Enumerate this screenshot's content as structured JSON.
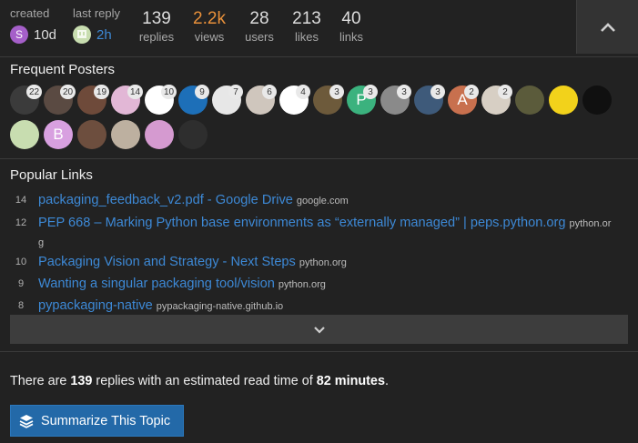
{
  "stats": {
    "created_label": "created",
    "created_initial": "S",
    "created_value": "10d",
    "last_reply_label": "last reply",
    "last_reply_value": "2h",
    "replies_value": "139",
    "replies_label": "replies",
    "views_value": "2.2k",
    "views_label": "views",
    "users_value": "28",
    "users_label": "users",
    "likes_value": "213",
    "likes_label": "likes",
    "links_value": "40",
    "links_label": "links"
  },
  "posters": {
    "title": "Frequent Posters",
    "row1": [
      {
        "count": "22",
        "color": "#3b3b3b"
      },
      {
        "count": "20",
        "color": "#5a4a42"
      },
      {
        "count": "19",
        "color": "#6e4a3a"
      },
      {
        "count": "14",
        "color": "#e2b7d6"
      },
      {
        "count": "10",
        "color": "#ffffff"
      },
      {
        "count": "9",
        "color": "#1d6fb8"
      },
      {
        "count": "7",
        "color": "#e7e7e7"
      },
      {
        "count": "6",
        "color": "#cfc6bd"
      },
      {
        "count": "4",
        "color": "#ffffff"
      },
      {
        "count": "3",
        "color": "#6d5a3b"
      },
      {
        "count": "3",
        "color": "#3bb27e",
        "letter": "P"
      },
      {
        "count": "3",
        "color": "#8a8a8a"
      },
      {
        "count": "3",
        "color": "#3e5a7a"
      },
      {
        "count": "2",
        "color": "#c8704e",
        "letter": "A"
      },
      {
        "count": "2",
        "color": "#d7cfc4"
      },
      {
        "count": "",
        "color": "#5b5b3b"
      },
      {
        "count": "",
        "color": "#f2d21b"
      },
      {
        "count": "",
        "color": "#101010"
      }
    ],
    "row2": [
      {
        "count": "",
        "color": "#c8ddb0"
      },
      {
        "count": "",
        "color": "#d8a0e0",
        "letter": "B"
      },
      {
        "count": "",
        "color": "#6d4e3e"
      },
      {
        "count": "",
        "color": "#bdb0a0"
      },
      {
        "count": "",
        "color": "#d59ad0"
      },
      {
        "count": "",
        "color": "#2e2e2e"
      }
    ]
  },
  "links": {
    "title": "Popular Links",
    "items": [
      {
        "count": "14",
        "title": "packaging_feedback_v2.pdf - Google Drive",
        "domain": "google.com"
      },
      {
        "count": "12",
        "title": "PEP 668 – Marking Python base environments as “externally managed” | peps.python.org",
        "domain": "python.or",
        "domain_wrap": "g"
      },
      {
        "count": "10",
        "title": "Packaging Vision and Strategy - Next Steps",
        "domain": "python.org"
      },
      {
        "count": "9",
        "title": "Wanting a singular packaging tool/vision",
        "domain": "python.org"
      },
      {
        "count": "8",
        "title": "pypackaging-native",
        "domain": "pypackaging-native.github.io"
      }
    ]
  },
  "summary": {
    "prefix": "There are ",
    "replies": "139",
    "middle": " replies with an estimated read time of ",
    "minutes": "82 minutes",
    "suffix": ".",
    "button_label": "Summarize This Topic"
  },
  "colors": {
    "accent": "#2369a8",
    "link": "#3d89d6",
    "views": "#e8903a"
  },
  "icons": {
    "collapse": "chevron-up-icon",
    "expand": "chevron-down-icon",
    "summarize": "layers-icon"
  }
}
